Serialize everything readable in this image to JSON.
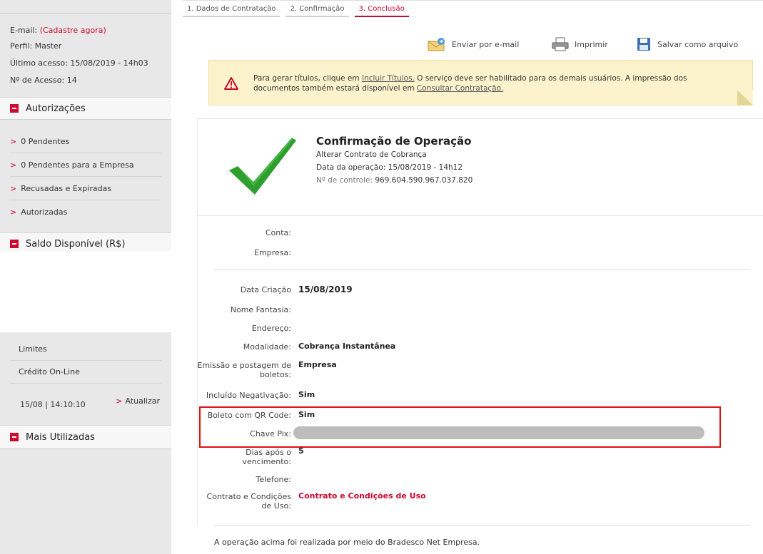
{
  "sidebar": {
    "email_label": "E-mail:",
    "email_link": "(Cadastre agora)",
    "perfil": "Perfil: Master",
    "ultimo_acesso": "Último acesso: 15/08/2019 - 14h03",
    "num_acesso": "Nº de Acesso: 14",
    "sections": {
      "autorizacoes": "Autorizações",
      "saldo": "Saldo Disponível (R$)",
      "mais_utilizadas": "Mais Utilizadas"
    },
    "auth_items": [
      "0 Pendentes",
      "0 Pendentes para a Empresa",
      "Recusadas e Expiradas",
      "Autorizadas"
    ],
    "limites": "Limites",
    "credito": "Crédito On-Line",
    "timestamp": "15/08 | 14:10:10",
    "atualizar": "Atualizar"
  },
  "steps": [
    "1. Dados de Contratação",
    "2. Confirmação",
    "3. Conclusão"
  ],
  "toolbar": {
    "email": "Enviar por e-mail",
    "print": "Imprimir",
    "save": "Salvar como arquivo"
  },
  "warning": {
    "t1": "Para gerar títulos, clique em ",
    "link1": "Incluir Títulos.",
    "t2": " O serviço deve ser habilitado para os demais usuários. A impressão dos documentos também estará disponível em ",
    "link2": "Consultar Contratação."
  },
  "operation": {
    "title": "Confirmação de Operação",
    "subtitle": "Alterar Contrato de Cobrança",
    "date": "Data da operação: 15/08/2019 - 14h12",
    "control_label": "Nº de controle:",
    "control_value": "969.604.590.967.037.820"
  },
  "fields": {
    "conta": "Conta:",
    "empresa": "Empresa:",
    "data_criacao_label": "Data Criação",
    "data_criacao_value": "15/08/2019",
    "nome_fantasia": "Nome Fantasia:",
    "endereco": "Endereço:",
    "modalidade_label": "Modalidade:",
    "modalidade_value": "Cobrança Instantânea",
    "emissao_label_1": "Emissão e postagem de",
    "emissao_label_2": "boletos:",
    "emissao_value": "Empresa",
    "negativacao_label": "Incluído Negativação:",
    "negativacao_value": "Sim",
    "qrcode_label": "Boleto com QR Code:",
    "qrcode_value": "Sim",
    "pix_label": "Chave Pix:",
    "dias_label_1": "Dias após o",
    "dias_label_2": "vencimento:",
    "dias_value": "5",
    "telefone": "Telefone:",
    "contrato_label_1": "Contrato e Condições",
    "contrato_label_2": "de Uso:",
    "contrato_value": "Contrato e Condições de Uso"
  },
  "footer": "A operação acima foi realizada por meio do Bradesco Net Empresa.",
  "colors": {
    "brand": "#cc092f",
    "highlight": "#e01010",
    "check": "#2e9e2e"
  }
}
